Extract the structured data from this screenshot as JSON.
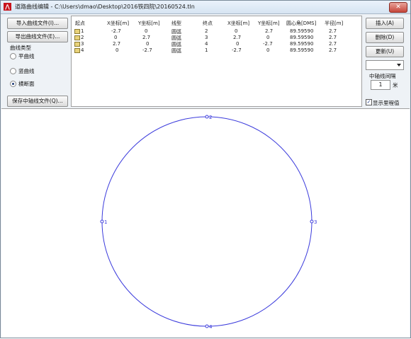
{
  "window": {
    "title": "道路曲线编辑 - C:\\Users\\dmao\\Desktop\\2016铁四院\\20160524.tln",
    "close_label": "✕"
  },
  "left_panel": {
    "import_button": "导入曲线文件(I)...",
    "export_button": "导出曲线文件(E)...",
    "curve_type_label": "曲线类型",
    "radio_plane": "平曲线",
    "radio_vertical": "竖曲线",
    "radio_cross": "横断面",
    "save_button": "保存中轴线文件(Q)..."
  },
  "table": {
    "headers": [
      "起点",
      "X坐标[m]",
      "Y坐标[m]",
      "线型",
      "终点",
      "X坐标[m]",
      "Y坐标[m]",
      "圆心角[DMS]",
      "半径[m]"
    ],
    "rows": [
      [
        "1",
        "-2.7",
        "0",
        "圆弧",
        "2",
        "0",
        "2.7",
        "89.59590",
        "2.7"
      ],
      [
        "2",
        "0",
        "2.7",
        "圆弧",
        "3",
        "2.7",
        "0",
        "89.59590",
        "2.7"
      ],
      [
        "3",
        "2.7",
        "0",
        "圆弧",
        "4",
        "0",
        "-2.7",
        "89.59590",
        "2.7"
      ],
      [
        "4",
        "0",
        "-2.7",
        "圆弧",
        "1",
        "-2.7",
        "0",
        "89.59590",
        "2.7"
      ]
    ]
  },
  "right_panel": {
    "insert_button": "插入(A)",
    "delete_button": "删除(D)",
    "update_button": "更新(U)",
    "dropdown_value": "",
    "spacing_label": "中轴线间隔",
    "spacing_value": "1",
    "spacing_unit": "米",
    "show_mileage_label": "显示里程值",
    "show_mileage_checked": true
  },
  "canvas": {
    "stroke_color": "#3b3bdc",
    "point_labels": [
      "1",
      "2",
      "3",
      "4"
    ]
  }
}
